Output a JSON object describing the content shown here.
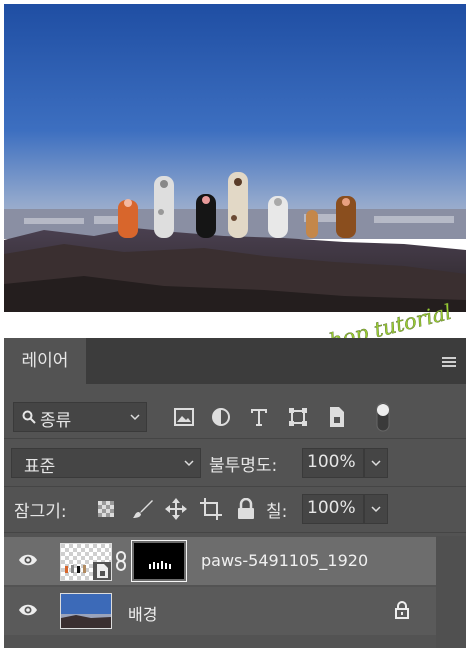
{
  "watermark": {
    "text": "Cälin's photoshop tutorial"
  },
  "layers_panel": {
    "tab_label": "레이어",
    "filter": {
      "label": "종류",
      "icons": [
        "image-filter-icon",
        "adjustment-filter-icon",
        "type-filter-icon",
        "shape-filter-icon",
        "smart-object-filter-icon",
        "filter-toggle-icon"
      ]
    },
    "blend_mode": "표준",
    "opacity": {
      "label": "불투명도:",
      "value": "100%"
    },
    "lock": {
      "label": "잠그기:"
    },
    "fill": {
      "label": "칠:",
      "value": "100%"
    },
    "layers": [
      {
        "name": "paws-5491105_1920",
        "visible": true,
        "selected": true,
        "has_mask": true
      },
      {
        "name": "배경",
        "visible": true,
        "selected": false,
        "locked": true
      }
    ]
  },
  "colors": {
    "panel_bg": "#535353",
    "tabbar_bg": "#3c3c3c",
    "field_bg": "#454545",
    "selected_row": "#6d6d6d",
    "watermark": "#9acd32"
  }
}
